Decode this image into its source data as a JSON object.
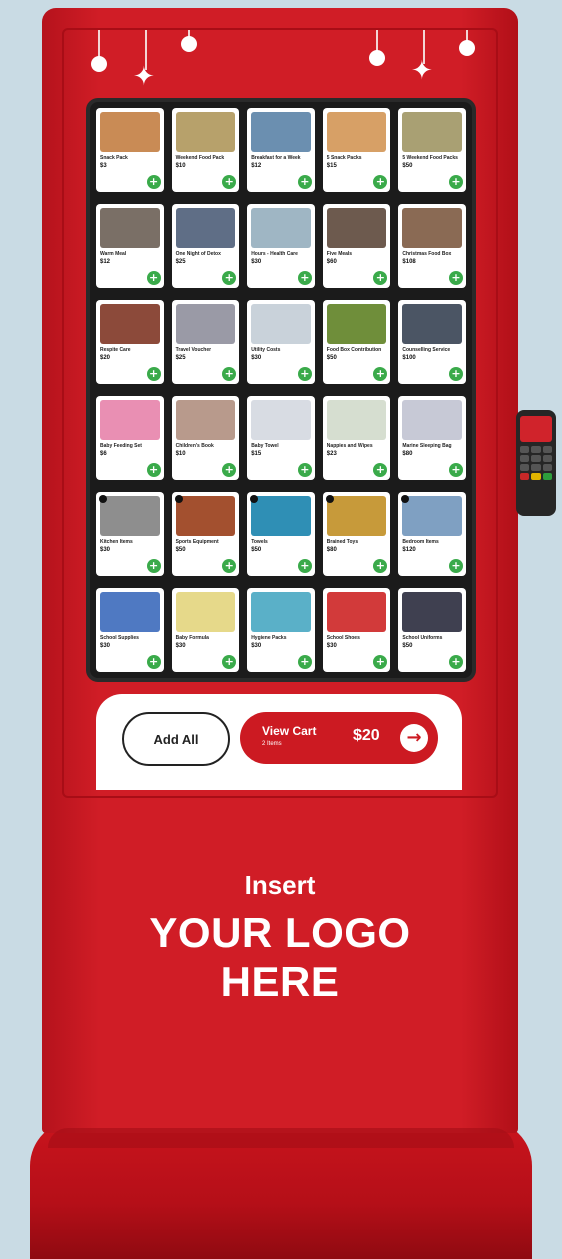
{
  "colors": {
    "accent": "#cc1a22",
    "plus": "#3aaa4a",
    "screen": "#1b1b1b"
  },
  "catalog": {
    "rows": [
      [
        {
          "name": "Snack Pack",
          "price": "$3",
          "thumb": "#c98b55"
        },
        {
          "name": "Weekend Food Pack",
          "price": "$10",
          "thumb": "#b7a16b"
        },
        {
          "name": "Breakfast for a Week",
          "price": "$12",
          "thumb": "#6b8fb0"
        },
        {
          "name": "5 Snack Packs",
          "price": "$15",
          "thumb": "#d7a066"
        },
        {
          "name": "5 Weekend Food Packs",
          "price": "$50",
          "thumb": "#a9a073"
        }
      ],
      [
        {
          "name": "Warm Meal",
          "price": "$12",
          "thumb": "#7a6f66"
        },
        {
          "name": "One Night of Detox",
          "price": "$25",
          "thumb": "#5f6e86"
        },
        {
          "name": "Hours - Health Care",
          "price": "$30",
          "thumb": "#9fb6c4"
        },
        {
          "name": "Five Meals",
          "price": "$60",
          "thumb": "#6d5a4e"
        },
        {
          "name": "Christmas Food Box",
          "price": "$108",
          "thumb": "#8a6a54"
        }
      ],
      [
        {
          "name": "Respite Care",
          "price": "$20",
          "thumb": "#8c4a3a"
        },
        {
          "name": "Travel Voucher",
          "price": "$25",
          "thumb": "#9a9aa6"
        },
        {
          "name": "Utility Costs",
          "price": "$30",
          "thumb": "#c9d2da"
        },
        {
          "name": "Food Box Contribution",
          "price": "$50",
          "thumb": "#6f8e3a"
        },
        {
          "name": "Counselling Service",
          "price": "$100",
          "thumb": "#4b5564"
        }
      ],
      [
        {
          "name": "Baby Feeding Set",
          "price": "$6",
          "thumb": "#e98fb3"
        },
        {
          "name": "Children's Book",
          "price": "$10",
          "thumb": "#b89a8c"
        },
        {
          "name": "Baby Towel",
          "price": "$15",
          "thumb": "#d8dce3"
        },
        {
          "name": "Nappies and Wipes",
          "price": "$23",
          "thumb": "#d6ded0"
        },
        {
          "name": "Marine Sleeping Bag",
          "price": "$80",
          "thumb": "#c7c9d6"
        }
      ],
      [
        {
          "name": "Kitchen Items",
          "price": "$30",
          "thumb": "#8e8e8e"
        },
        {
          "name": "Sports Equipment",
          "price": "$50",
          "thumb": "#a3502f"
        },
        {
          "name": "Towels",
          "price": "$50",
          "thumb": "#2f8fb5"
        },
        {
          "name": "Brained Toys",
          "price": "$80",
          "thumb": "#c79a3a"
        },
        {
          "name": "Bedroom Items",
          "price": "$120",
          "thumb": "#7fa0c2"
        }
      ],
      [
        {
          "name": "School Supplies",
          "price": "$30",
          "thumb": "#4f79c2"
        },
        {
          "name": "Baby Formula",
          "price": "$30",
          "thumb": "#e6d98a"
        },
        {
          "name": "Hygiene Packs",
          "price": "$30",
          "thumb": "#5ab0c8"
        },
        {
          "name": "School Shoes",
          "price": "$30",
          "thumb": "#d23a3a"
        },
        {
          "name": "School Uniforms",
          "price": "$50",
          "thumb": "#3f4050"
        }
      ]
    ]
  },
  "cart": {
    "add_all_label": "Add All",
    "view_cart_label": "View Cart",
    "items_count": "2 Items",
    "total": "$20",
    "arrow_icon": "arrow-right-icon"
  },
  "branding": {
    "insert": "Insert",
    "logo_line1": "YOUR LOGO",
    "logo_line2": "HERE"
  }
}
